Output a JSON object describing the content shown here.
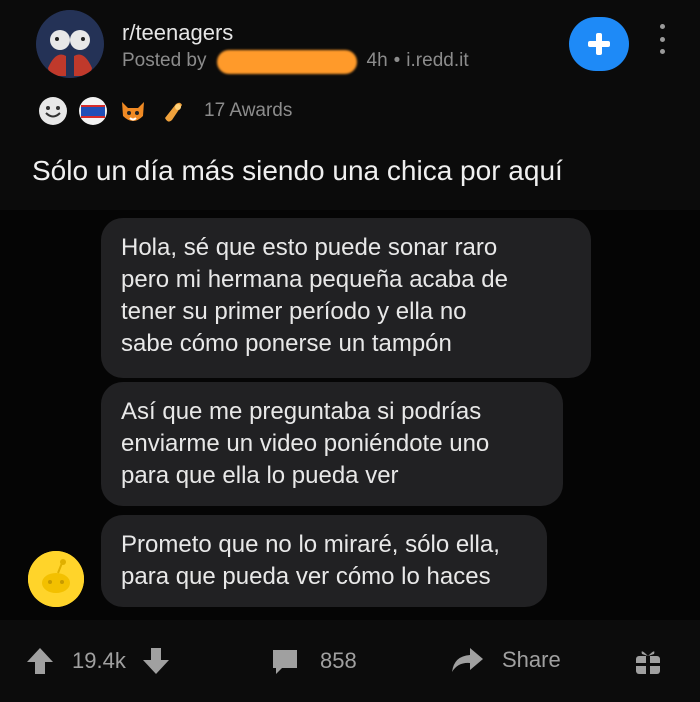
{
  "post": {
    "subreddit": "r/teenagers",
    "posted_by_prefix": "Posted by",
    "age": "4h",
    "separator": "•",
    "domain": "i.redd.it",
    "awards_count": "17 Awards",
    "title": "Sólo un día más siendo una chica por aquí"
  },
  "messages": [
    {
      "lines": [
        "Hola, sé que esto puede sonar raro",
        "pero mi hermana pequeña acaba de",
        "tener su primer período y ella no",
        "sabe cómo ponerse un tampón"
      ]
    },
    {
      "lines": [
        "Así que me preguntaba si podrías",
        "enviarme un video poniéndote uno",
        "para que ella lo pueda ver"
      ]
    },
    {
      "lines": [
        "Prometo que no lo miraré, sólo ella,",
        "para que pueda ver cómo lo haces"
      ]
    }
  ],
  "actions": {
    "score": "19.4k",
    "comments": "858",
    "share": "Share"
  },
  "colors": {
    "accent_blue": "#1e8af7",
    "bubble": "#212123",
    "redaction": "#ff9a2a",
    "snoo": "#ffd42a"
  },
  "icons": [
    "plus-icon",
    "more-options-icon",
    "upvote-icon",
    "downvote-icon",
    "comment-icon",
    "share-icon",
    "gift-icon"
  ]
}
